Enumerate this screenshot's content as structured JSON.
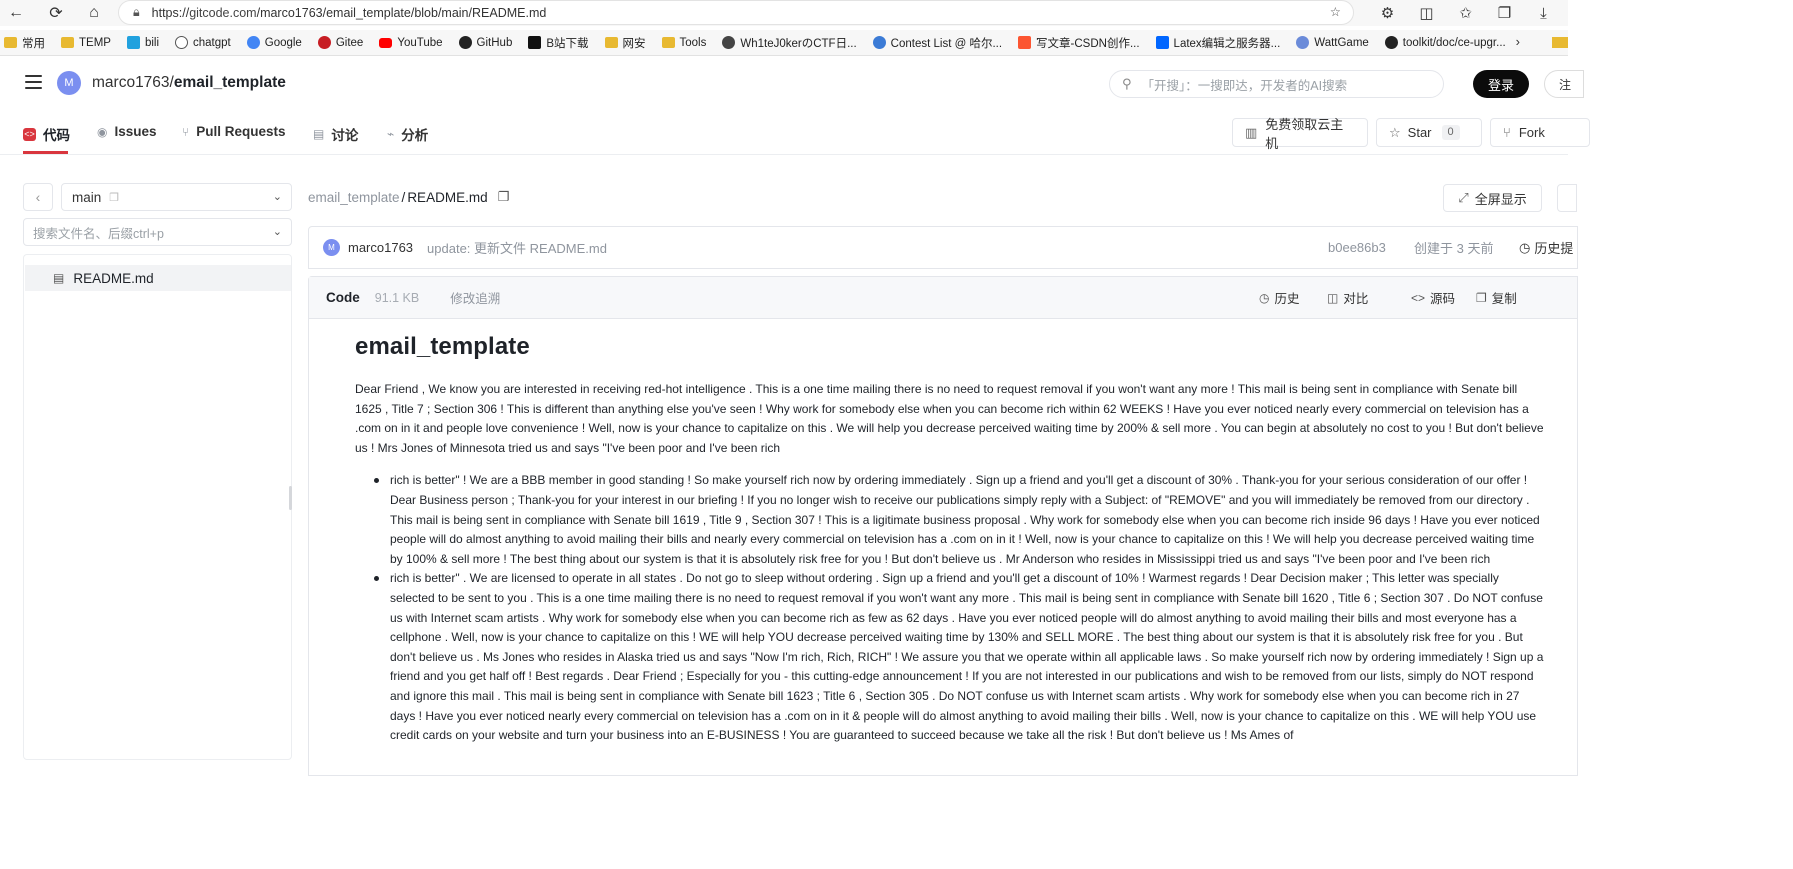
{
  "browser": {
    "url_prefix": "https://",
    "url_host": "gitcode.com",
    "url_path": "/marco1763/email_template/blob/main/README.md",
    "bookmarks": [
      "常用",
      "TEMP",
      "bili",
      "chatgpt",
      "Google",
      "Gitee",
      "YouTube",
      "GitHub",
      "B站下载",
      "网安",
      "Tools",
      "Wh1teJ0kerのCTF日...",
      "Contest List @ 哈尔...",
      "写文章-CSDN创作...",
      "Latex编辑之服务器...",
      "WattGame",
      "toolkit/doc/ce-upgr..."
    ]
  },
  "header": {
    "avatar_letter": "M",
    "owner": "marco1763",
    "separator": "/",
    "repo": "email_template",
    "search_placeholder": "「开搜」：一搜即达，开发者的AI搜索",
    "login_label": "登录",
    "register_label": "注"
  },
  "tabs": {
    "code": "代码",
    "issues": "Issues",
    "pulls": "Pull Requests",
    "discussion": "讨论",
    "analysis": "分析",
    "cloud_label": "免费领取云主机",
    "star_label": "Star",
    "star_count": "0",
    "fork_label": "Fork"
  },
  "sidebar": {
    "branch": "main",
    "file_search_placeholder": "搜索文件名、后缀ctrl+p",
    "files": [
      "README.md"
    ]
  },
  "file": {
    "crumb_repo": "email_template",
    "crumb_sep": "/",
    "crumb_file": "README.md",
    "fullscreen_label": "全屏显示",
    "commit_author_letter": "M",
    "commit_author": "marco1763",
    "commit_message": "update: 更新文件 README.md",
    "commit_hash": "b0ee86b3",
    "created": "创建于 3 天前",
    "history_label": "历史提",
    "code_label": "Code",
    "size": "91.1 KB",
    "blame_label": "修改追溯",
    "actions": {
      "history": "历史",
      "compare": "对比",
      "raw": "源码",
      "copy": "复制"
    }
  },
  "readme": {
    "title": "email_template",
    "para": "Dear Friend , We know you are interested in receiving red-hot intelligence . This is a one time mailing there is no need to request removal if you won't want any more ! This mail is being sent in compliance with Senate bill 1625 , Title 7 ; Section 306 ! This is different than anything else you've seen ! Why work for somebody else when you can become rich within 62 WEEKS ! Have you ever noticed nearly every commercial on television has a .com on in it and people love convenience ! Well, now is your chance to capitalize on this . We will help you decrease perceived waiting time by 200% & sell more . You can begin at absolutely no cost to you ! But don't believe us ! Mrs Jones of Minnesota tried us and says \"I've been poor and I've been rich",
    "items": [
      "rich is better\" ! We are a BBB member in good standing ! So make yourself rich now by ordering immediately . Sign up a friend and you'll get a discount of 30% . Thank-you for your serious consideration of our offer ! Dear Business person ; Thank-you for your interest in our briefing ! If you no longer wish to receive our publications simply reply with a Subject: of \"REMOVE\" and you will immediately be removed from our directory . This mail is being sent in compliance with Senate bill 1619 , Title 9 , Section 307 ! This is a ligitimate business proposal . Why work for somebody else when you can become rich inside 96 days ! Have you ever noticed people will do almost anything to avoid mailing their bills and nearly every commercial on television has a .com on in it ! Well, now is your chance to capitalize on this ! We will help you decrease perceived waiting time by 100% & sell more ! The best thing about our system is that it is absolutely risk free for you ! But don't believe us . Mr Anderson who resides in Mississippi tried us and says \"I've been poor and I've been rich",
      "rich is better\" . We are licensed to operate in all states . Do not go to sleep without ordering . Sign up a friend and you'll get a discount of 10% ! Warmest regards ! Dear Decision maker ; This letter was specially selected to be sent to you . This is a one time mailing there is no need to request removal if you won't want any more . This mail is being sent in compliance with Senate bill 1620 , Title 6 ; Section 307 . Do NOT confuse us with Internet scam artists . Why work for somebody else when you can become rich as few as 62 days . Have you ever noticed people will do almost anything to avoid mailing their bills and most everyone has a cellphone . Well, now is your chance to capitalize on this ! WE will help YOU decrease perceived waiting time by 130% and SELL MORE . The best thing about our system is that it is absolutely risk free for you . But don't believe us . Ms Jones who resides in Alaska tried us and says \"Now I'm rich, Rich, RICH\" ! We assure you that we operate within all applicable laws . So make yourself rich now by ordering immediately ! Sign up a friend and you get half off ! Best regards . Dear Friend ; Especially for you - this cutting-edge announcement ! If you are not interested in our publications and wish to be removed from our lists, simply do NOT respond and ignore this mail . This mail is being sent in compliance with Senate bill 1623 ; Title 6 , Section 305 . Do NOT confuse us with Internet scam artists . Why work for somebody else when you can become rich in 27 days ! Have you ever noticed nearly every commercial on television has a .com on in it & people will do almost anything to avoid mailing their bills . Well, now is your chance to capitalize on this . WE will help YOU use credit cards on your website and turn your business into an E-BUSINESS ! You are guaranteed to succeed because we take all the risk ! But don't believe us ! Ms Ames of"
    ]
  }
}
